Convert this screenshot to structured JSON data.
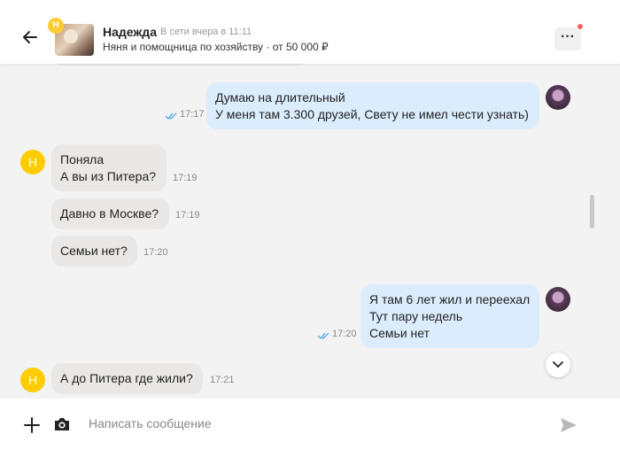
{
  "header": {
    "back_icon": "arrow-left-icon",
    "badge_letter": "Н",
    "name": "Надежда",
    "status": "В сети вчера в 11:11",
    "subtitle": "Няня и помощница по хозяйству · от 50 000 ₽",
    "more_label": "···",
    "notification_color": "#ff5c5c"
  },
  "messages": [
    {
      "side": "out",
      "lines": [
        "Думаю на длительный",
        "У меня там 3.300 друзей, Свету не имел чести узнать)"
      ],
      "time": "17:17"
    },
    {
      "side": "in",
      "avatar": "Н",
      "lines": [
        "Поняла",
        "А вы из Питера?"
      ],
      "time": "17:19"
    },
    {
      "side": "in",
      "lines": [
        "Давно в Москве?"
      ],
      "time": "17:19"
    },
    {
      "side": "in",
      "lines": [
        "Семьи нет?"
      ],
      "time": "17:20"
    },
    {
      "side": "out",
      "lines": [
        "Я там 6 лет жил и переехал",
        "Тут пару недель",
        "Семьи нет"
      ],
      "time": "17:20"
    },
    {
      "side": "in",
      "avatar": "Н",
      "lines": [
        "А до Питера где жили?"
      ],
      "time": "17:21"
    }
  ],
  "composer": {
    "placeholder": "Написать сообщение",
    "value": "",
    "icons": [
      "plus-icon",
      "camera-icon",
      "send-icon"
    ]
  },
  "colors": {
    "incoming_bubble": "#e9e8e6",
    "outgoing_bubble": "#dbedfd",
    "avatar_yellow": "#ffcc00",
    "read_ticks": "#3aa0e8"
  }
}
